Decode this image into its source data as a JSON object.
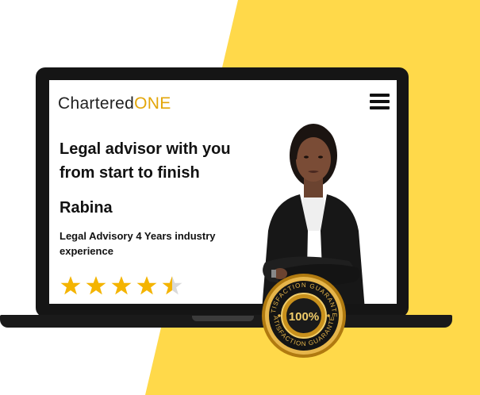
{
  "brand": {
    "name_part1": "Chartered",
    "name_part2": "ONE"
  },
  "hero": {
    "headline": "Legal advisor with you from start to finish",
    "advisor_name": "Rabina",
    "advisor_description": "Legal Advisory 4 Years industry experience",
    "rating": 4.5,
    "rating_max": 5
  },
  "badge": {
    "top_text": "SATISFACTION GUARANTEE",
    "center_text": "100%",
    "bottom_text": "SATISFACTION GUARANTEE"
  },
  "icons": {
    "menu": "hamburger-menu-icon",
    "star": "star-icon"
  },
  "colors": {
    "accent": "#ffd94a",
    "brand": "#e3a60a",
    "star": "#f4b400",
    "star_empty": "#d9d9d9"
  }
}
